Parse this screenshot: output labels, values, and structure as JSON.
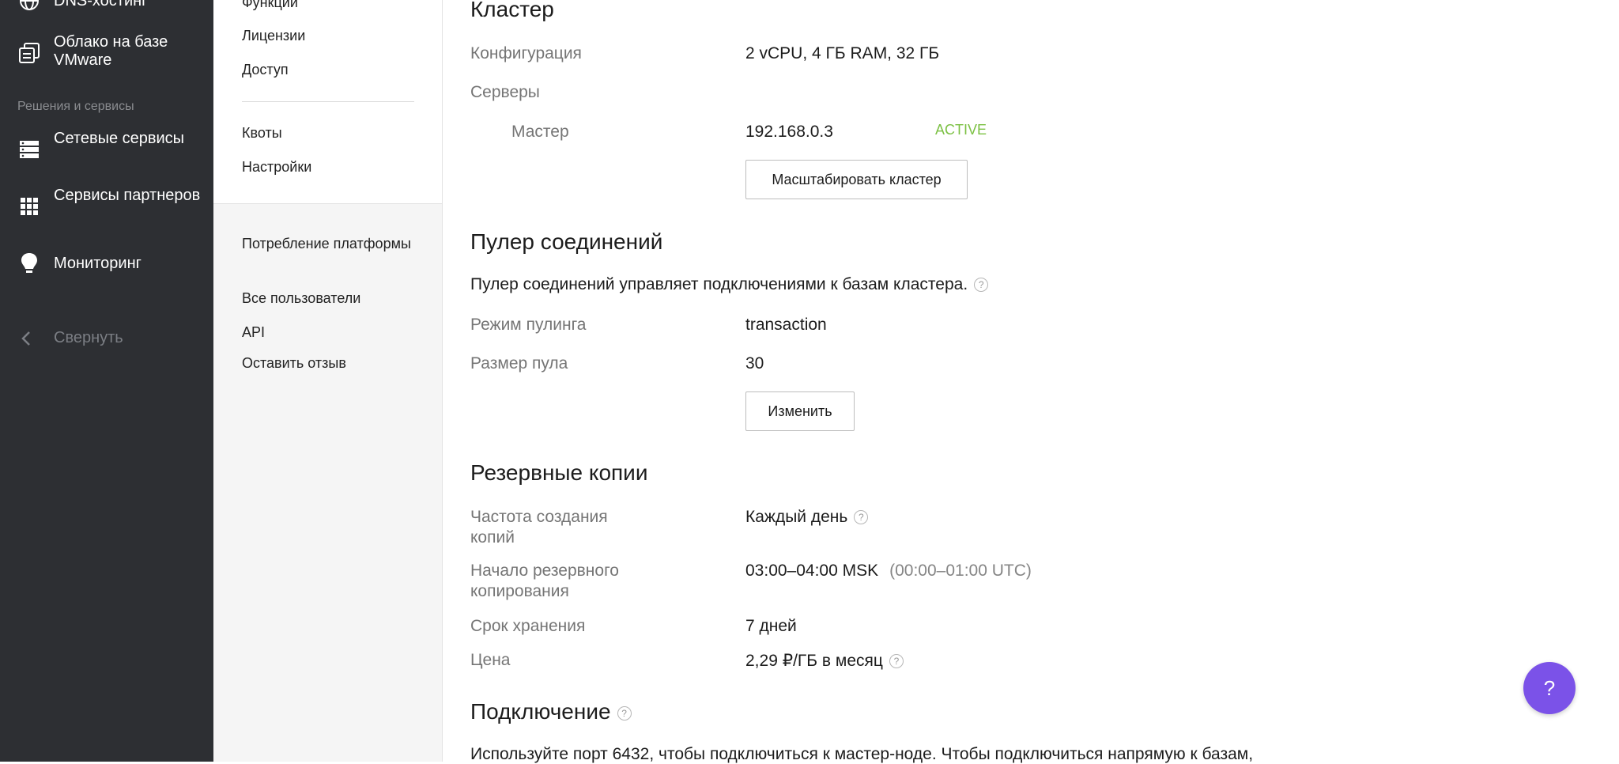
{
  "nav": {
    "top_item": "DNS-хостинг",
    "vmware": "Облако на базе VMware",
    "section_label": "Решения и сервисы",
    "network": "Сетевые сервисы",
    "partners": "Сервисы партнеров",
    "monitoring": "Мониторинг",
    "collapse": "Свернуть"
  },
  "subnav": {
    "items_top": [
      "Функции",
      "Лицензии",
      "Доступ"
    ],
    "items_mid": [
      "Квоты",
      "Настройки"
    ],
    "items_bottom": [
      "Потребление платформы",
      "Все пользователи",
      "API",
      "Оставить отзыв"
    ]
  },
  "cluster": {
    "title": "Кластер",
    "config_label": "Конфигурация",
    "config_value": "2 vCPU, 4 ГБ RAM, 32 ГБ",
    "servers_label": "Серверы",
    "master_label": "Мастер",
    "master_ip": "192.168.0.3",
    "master_status": "ACTIVE",
    "scale_button": "Масштабировать кластер"
  },
  "pooler": {
    "title": "Пулер соединений",
    "description": "Пулер соединений управляет подключениями к базам кластера.",
    "mode_label": "Режим пулинга",
    "mode_value": "transaction",
    "size_label": "Размер пула",
    "size_value": "30",
    "edit_button": "Изменить"
  },
  "backups": {
    "title": "Резервные копии",
    "freq_label": "Частота создания копий",
    "freq_value": "Каждый день",
    "start_label": "Начало резервного копирования",
    "start_value": "03:00–04:00 MSK",
    "start_utc": "(00:00–01:00 UTC)",
    "retention_label": "Срок хранения",
    "retention_value": "7 дней",
    "price_label": "Цена",
    "price_value": "2,29 ₽/ГБ в месяц"
  },
  "connection": {
    "title": "Подключение",
    "text": "Используйте порт 6432, чтобы подключиться к мастер-ноде. Чтобы подключиться напрямую к базам,"
  },
  "fab": {
    "label": "?"
  },
  "colors": {
    "nav_bg": "#2d2f33",
    "accent": "#7b52e8",
    "active": "#7cc144"
  }
}
